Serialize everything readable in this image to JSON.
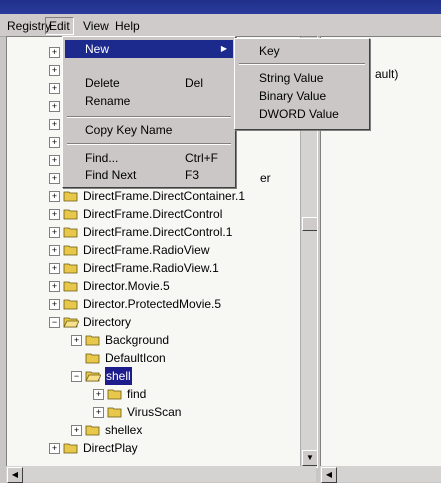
{
  "menubar": {
    "items": [
      "Registry",
      "Edit",
      "View",
      "Help"
    ]
  },
  "edit_menu": {
    "new": "New",
    "delete": "Delete",
    "delete_shortcut": "Del",
    "rename": "Rename",
    "copy_key_name": "Copy Key Name",
    "find": "Find...",
    "find_shortcut": "Ctrl+F",
    "find_next": "Find Next",
    "find_next_shortcut": "F3"
  },
  "new_submenu": {
    "items": [
      "Key",
      "String Value",
      "Binary Value",
      "DWORD Value"
    ]
  },
  "tree": {
    "obscured_label_fragment": "er",
    "items": [
      "DirectFrame.DirectContainer.1",
      "DirectFrame.DirectControl",
      "DirectFrame.DirectControl.1",
      "DirectFrame.RadioView",
      "DirectFrame.RadioView.1",
      "Director.Movie.5",
      "Director.ProtectedMovie.5",
      "Directory",
      "Background",
      "DefaultIcon",
      "shell",
      "find",
      "VirusScan",
      "shellex",
      "DirectPlay"
    ]
  },
  "right_pane": {
    "value_fragment": "ault)"
  },
  "colors": {
    "selection": "#1c1c8c",
    "folder": "#e8c84a",
    "menu_highlight": "#1b2a8c"
  }
}
